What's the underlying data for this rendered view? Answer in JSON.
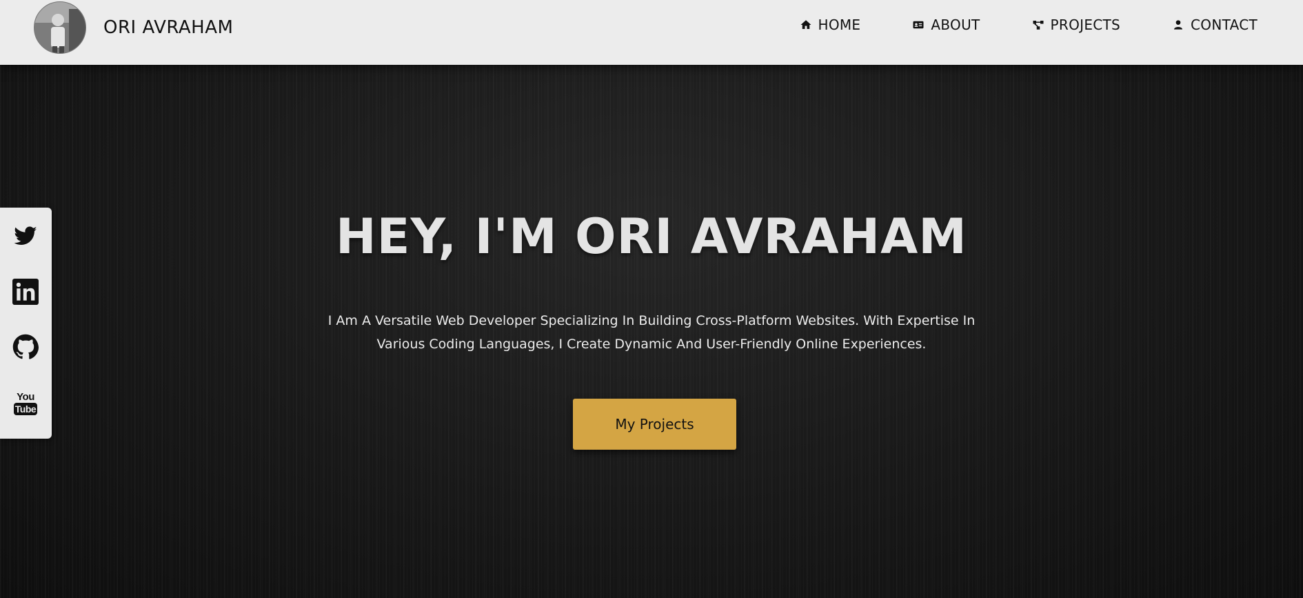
{
  "header": {
    "brand_name": "ORI AVRAHAM",
    "nav": [
      {
        "label": "HOME",
        "icon": "home-icon"
      },
      {
        "label": "ABOUT",
        "icon": "id-card-icon"
      },
      {
        "label": "PROJECTS",
        "icon": "share-nodes-icon"
      },
      {
        "label": "CONTACT",
        "icon": "user-icon"
      }
    ]
  },
  "hero": {
    "title": "HEY, I'M ORI AVRAHAM",
    "text_line1": "I Am A Versatile Web Developer Specializing In Building Cross-Platform Websites. With Expertise In",
    "text_line2": "Various Coding Languages, I Create Dynamic And User-Friendly Online Experiences.",
    "cta_label": "My Projects"
  },
  "social": [
    {
      "name": "twitter",
      "icon": "twitter-icon"
    },
    {
      "name": "linkedin",
      "icon": "linkedin-icon"
    },
    {
      "name": "github",
      "icon": "github-icon"
    },
    {
      "name": "youtube",
      "icon": "youtube-icon",
      "text_top": "You",
      "text_bottom": "Tube"
    }
  ],
  "colors": {
    "header_bg": "#ececec",
    "hero_bg": "#151515",
    "accent": "#d4a544",
    "title": "#e4e4e4"
  }
}
